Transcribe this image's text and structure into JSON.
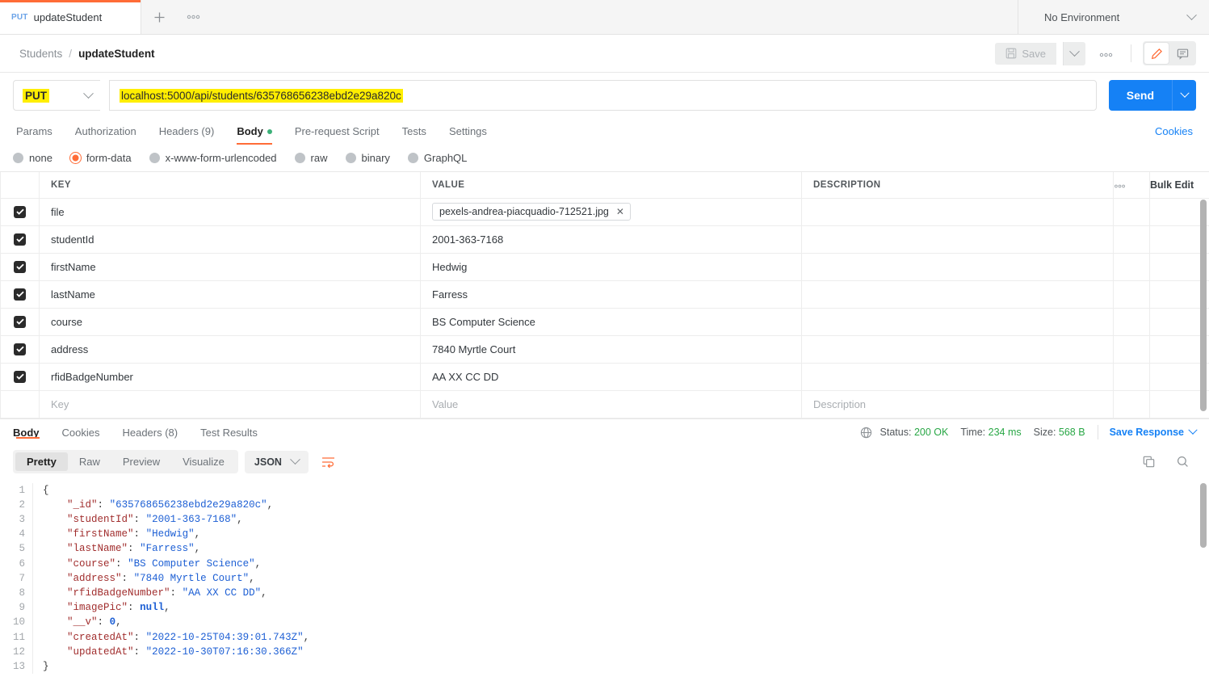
{
  "tab": {
    "method": "PUT",
    "title": "updateStudent",
    "plus_icon": "plus-icon",
    "more_icon": "ellipsis-icon"
  },
  "environment": {
    "selected": "No Environment",
    "caret_icon": "chevron-down-icon"
  },
  "breadcrumb": {
    "root": "Students",
    "separator": "/",
    "leaf": "updateStudent"
  },
  "toolbar": {
    "save_label": "Save",
    "save_icon": "floppy-disk-icon",
    "save_caret_icon": "chevron-down-icon",
    "more_icon": "ellipsis-icon",
    "edit_icon": "pencil-icon",
    "comment_icon": "comment-icon"
  },
  "request": {
    "method": "PUT",
    "method_caret_icon": "chevron-down-icon",
    "url": "localhost:5000/api/students/635768656238ebd2e29a820c",
    "send_label": "Send",
    "send_caret_icon": "chevron-down-icon",
    "highlight_color": "#ffee00",
    "send_color": "#1581f5"
  },
  "request_tabs": {
    "items": [
      {
        "label": "Params",
        "active": false,
        "dot": false
      },
      {
        "label": "Authorization",
        "active": false,
        "dot": false
      },
      {
        "label": "Headers (9)",
        "active": false,
        "dot": false
      },
      {
        "label": "Body",
        "active": true,
        "dot": true
      },
      {
        "label": "Pre-request Script",
        "active": false,
        "dot": false
      },
      {
        "label": "Tests",
        "active": false,
        "dot": false
      },
      {
        "label": "Settings",
        "active": false,
        "dot": false
      }
    ],
    "cookies_link": "Cookies"
  },
  "body_types": [
    {
      "label": "none",
      "selected": false
    },
    {
      "label": "form-data",
      "selected": true
    },
    {
      "label": "x-www-form-urlencoded",
      "selected": false
    },
    {
      "label": "raw",
      "selected": false
    },
    {
      "label": "binary",
      "selected": false
    },
    {
      "label": "GraphQL",
      "selected": false
    }
  ],
  "kv_table": {
    "headers": {
      "key": "KEY",
      "value": "VALUE",
      "description": "DESCRIPTION"
    },
    "more_icon": "ellipsis-icon",
    "bulk_edit": "Bulk Edit",
    "rows": [
      {
        "checked": true,
        "key": "file",
        "value": "pexels-andrea-piacquadio-712521.jpg",
        "is_file": true,
        "remove_icon": "close-icon",
        "description": ""
      },
      {
        "checked": true,
        "key": "studentId",
        "value": "2001-363-7168",
        "is_file": false,
        "description": ""
      },
      {
        "checked": true,
        "key": "firstName",
        "value": "Hedwig",
        "is_file": false,
        "description": ""
      },
      {
        "checked": true,
        "key": "lastName",
        "value": "Farress",
        "is_file": false,
        "description": ""
      },
      {
        "checked": true,
        "key": "course",
        "value": "BS Computer Science",
        "is_file": false,
        "description": ""
      },
      {
        "checked": true,
        "key": "address",
        "value": "7840 Myrtle Court",
        "is_file": false,
        "description": ""
      },
      {
        "checked": true,
        "key": "rfidBadgeNumber",
        "value": "AA XX CC DD",
        "is_file": false,
        "description": ""
      }
    ],
    "placeholder_row": {
      "key": "Key",
      "value": "Value",
      "description": "Description"
    }
  },
  "response": {
    "tabs": [
      {
        "label": "Body",
        "active": true
      },
      {
        "label": "Cookies",
        "active": false
      },
      {
        "label": "Headers (8)",
        "active": false
      },
      {
        "label": "Test Results",
        "active": false
      }
    ],
    "globe_icon": "globe-icon",
    "status_label": "Status:",
    "status_value": "200 OK",
    "time_label": "Time:",
    "time_value": "234 ms",
    "size_label": "Size:",
    "size_value": "568 B",
    "save_response": "Save Response",
    "save_response_caret_icon": "chevron-down-icon",
    "status_color": "#28a745",
    "format_tabs": [
      {
        "label": "Pretty",
        "active": true
      },
      {
        "label": "Raw",
        "active": false
      },
      {
        "label": "Preview",
        "active": false
      },
      {
        "label": "Visualize",
        "active": false
      }
    ],
    "language": "JSON",
    "language_caret_icon": "chevron-down-icon",
    "wrap_icon": "wrap-lines-icon",
    "copy_icon": "copy-icon",
    "search_icon": "search-icon",
    "line_numbers": [
      "1",
      "2",
      "3",
      "4",
      "5",
      "6",
      "7",
      "8",
      "9",
      "10",
      "11",
      "12",
      "13"
    ],
    "json": {
      "_id": "635768656238ebd2e29a820c",
      "studentId": "2001-363-7168",
      "firstName": "Hedwig",
      "lastName": "Farress",
      "course": "BS Computer Science",
      "address": "7840 Myrtle Court",
      "rfidBadgeNumber": "AA XX CC DD",
      "imagePic": null,
      "__v": 0,
      "createdAt": "2022-10-25T04:39:01.743Z",
      "updatedAt": "2022-10-30T07:16:30.366Z"
    }
  }
}
